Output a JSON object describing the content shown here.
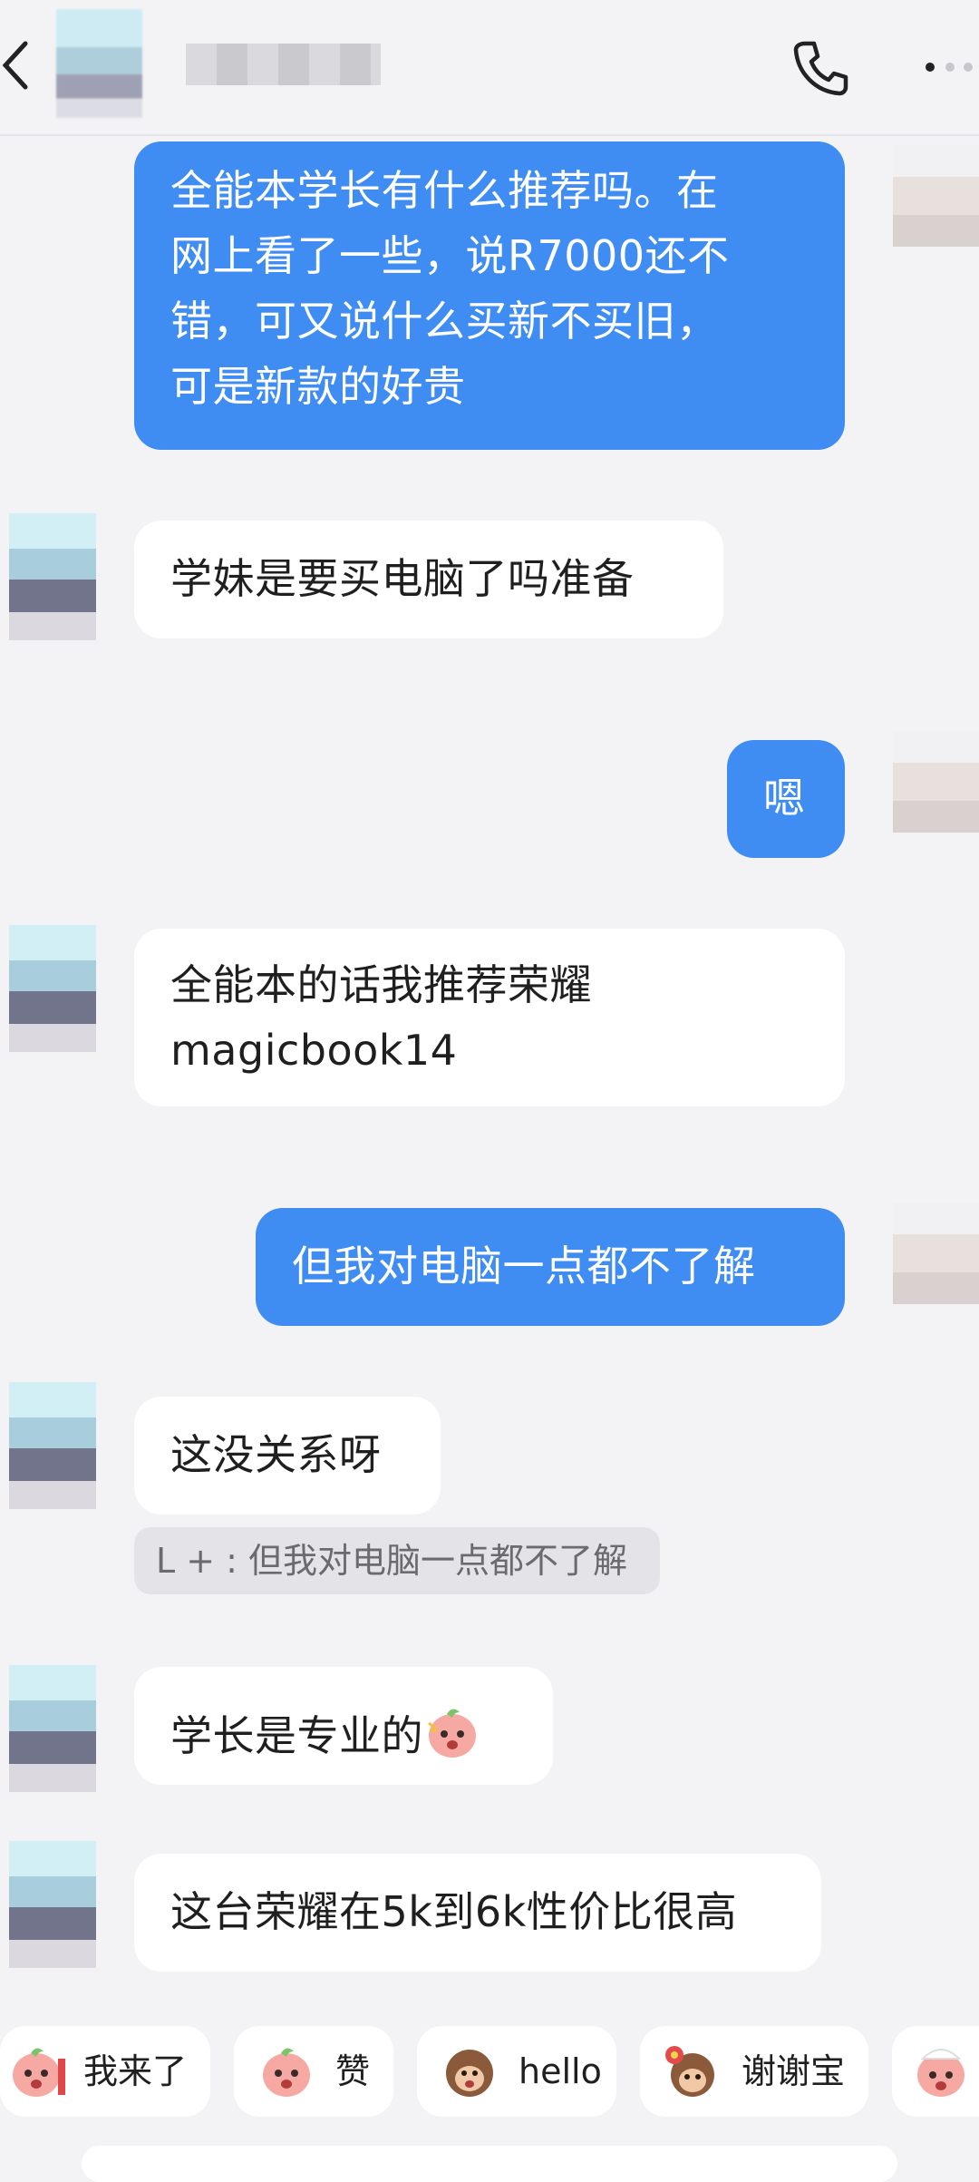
{
  "header": {
    "back_icon": "chevron-left-icon",
    "call_icon": "phone-icon",
    "more_icon": "more-dots-icon"
  },
  "messages": [
    {
      "from": "me",
      "text_lines": [
        "全能本学长有什么推荐吗。在",
        "网上看了一些，说R7000还不",
        "错，可又说什么买新不买旧，",
        "可是新款的好贵"
      ]
    },
    {
      "from": "them",
      "text": "学妹是要买电脑了吗准备"
    },
    {
      "from": "me",
      "text": "嗯"
    },
    {
      "from": "them",
      "text_lines": [
        "全能本的话我推荐荣耀",
        "magicbook14"
      ]
    },
    {
      "from": "me",
      "text": "但我对电脑一点都不了解"
    },
    {
      "from": "them",
      "text": "这没关系呀",
      "quote": "L + : 但我对电脑一点都不了解"
    },
    {
      "from": "them",
      "text": "学长是专业的",
      "sticker": "peach-sticker-icon"
    },
    {
      "from": "them",
      "text": "这台荣耀在5k到6k性价比很高"
    }
  ],
  "quick_replies": [
    {
      "label": "我来了",
      "icon": "peach-sticker-icon"
    },
    {
      "label": "赞",
      "icon": "peach-sticker-icon"
    },
    {
      "label": "hello",
      "icon": "monkey-sticker-icon"
    },
    {
      "label": "谢谢宝",
      "icon": "monkey-flower-sticker-icon"
    },
    {
      "label": "",
      "icon": "peach-sticker-icon"
    }
  ],
  "colors": {
    "outgoing_bubble": "#3f8cf2",
    "incoming_bubble": "#ffffff",
    "background": "#f3f3f5"
  }
}
